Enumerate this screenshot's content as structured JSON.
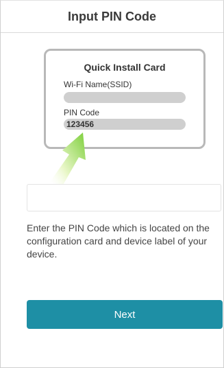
{
  "header": {
    "title": "Input PIN Code"
  },
  "card": {
    "title": "Quick Install Card",
    "ssid_label": "Wi-Fi Name(SSID)",
    "pin_label": "PIN Code",
    "pin_value": "123456"
  },
  "pin_input": {
    "value": "",
    "placeholder": ""
  },
  "instructions": "Enter the PIN Code which is located on the configuration card and device label of your device.",
  "next_button": {
    "label": "Next"
  },
  "colors": {
    "accent": "#1e8fa5",
    "arrow_light": "#eaf7c9",
    "arrow_dark": "#7ccf3a",
    "card_border": "#b8b8b8"
  }
}
